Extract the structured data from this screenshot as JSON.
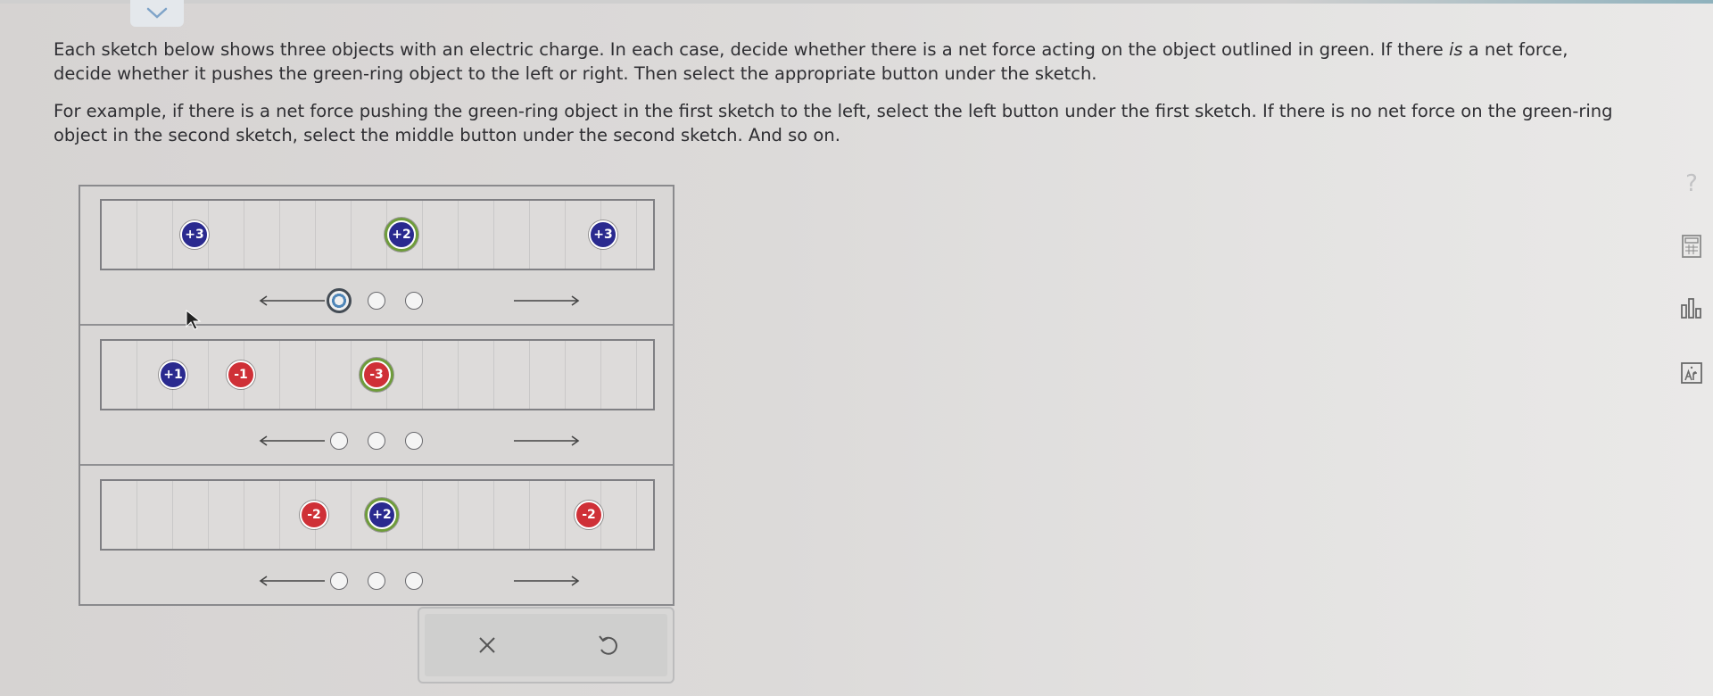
{
  "instructions": {
    "p1_part1": "Each sketch below shows three objects with an electric charge. In each case, decide whether there is a net force acting on the object outlined in green. If there ",
    "p1_is": "is",
    "p1_part2": " a net force, decide whether it pushes the green-ring object to the left or right. Then select the appropriate button under the sketch.",
    "p2": "For example, if there is a net force pushing the green-ring object in the first sketch to the left, select the left button under the first sketch. If there is no net force on the green-ring object in the second sketch, select the middle button under the second sketch. And so on."
  },
  "sketches": [
    {
      "charges": [
        {
          "label": "+3",
          "sign": "positive",
          "target": false
        },
        {
          "label": "+2",
          "sign": "positive",
          "target": true
        },
        {
          "label": "+3",
          "sign": "positive",
          "target": false
        }
      ],
      "selected_choice": "left"
    },
    {
      "charges": [
        {
          "label": "+1",
          "sign": "positive",
          "target": false
        },
        {
          "label": "-1",
          "sign": "negative",
          "target": false
        },
        {
          "label": "-3",
          "sign": "negative",
          "target": true
        }
      ],
      "selected_choice": null
    },
    {
      "charges": [
        {
          "label": "-2",
          "sign": "negative",
          "target": false
        },
        {
          "label": "+2",
          "sign": "positive",
          "target": true
        },
        {
          "label": "-2",
          "sign": "negative",
          "target": false
        }
      ],
      "selected_choice": null
    }
  ],
  "side_tools": {
    "help_glyph": "?"
  },
  "icons": [
    "chevron-down-icon",
    "close-icon",
    "undo-icon",
    "help-icon",
    "calculator-icon",
    "chart-icon",
    "periodic-table-icon",
    "cursor-icon"
  ],
  "colors": {
    "positive": "#2a2a8f",
    "negative": "#cf3037",
    "target_ring": "#6e9c3a",
    "selected_radio": "#4f86b8"
  }
}
